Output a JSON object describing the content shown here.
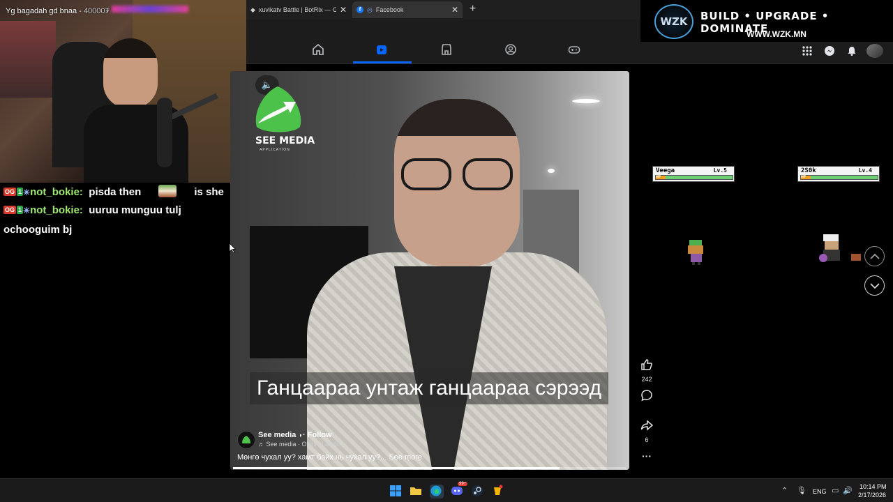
{
  "webcam_overlay": {
    "text": "Yg bagadah gd bnaa - ",
    "amount": "40000₮"
  },
  "chat": [
    {
      "badges": [
        "OG",
        "1"
      ],
      "user": "not_bokie:",
      "message": "pisda then",
      "emote": true,
      "after_emote": "is she"
    },
    {
      "badges": [
        "OG",
        "1"
      ],
      "user": "not_bokie:",
      "message": "uuruu munguu tulj"
    },
    {
      "continuation": "ochooguim bj"
    }
  ],
  "browser": {
    "tabs": [
      {
        "title": "xuvikatv Battle | BotRix — Cloud S",
        "active": false
      },
      {
        "title": "Facebook",
        "active": true
      }
    ],
    "nav": [
      "home-icon",
      "reels-icon",
      "marketplace-icon",
      "profile-icon",
      "gaming-icon"
    ],
    "active_nav": "reels-icon",
    "right_icons": [
      "menu-grid-icon",
      "messenger-icon",
      "notifications-icon",
      "account-avatar"
    ]
  },
  "banner": {
    "logo": "WZK",
    "tagline": "BUILD • UPGRADE • DOMINATE",
    "url": "WWW.WZK.MN"
  },
  "reel": {
    "watermark": "SEE MEDIA",
    "watermark_sub": "APPLICATION",
    "subtitle": "Ганцаараа унтаж ганцаараа сэрээд",
    "author": "See media",
    "follow": "· Follow",
    "audio": "♬ See media · Original audio",
    "caption": "Мөнгө чухал уу? хамт байх нь чухал уу?...",
    "see_more": "See more",
    "progress": 0.83,
    "likes": "242",
    "shares": "6"
  },
  "game": {
    "players": [
      {
        "name": "Veega",
        "level": "Lv.5",
        "hp": 1.0
      },
      {
        "name": "2S0k",
        "level": "Lv.4",
        "hp": 1.0
      }
    ],
    "hp_label": "HP"
  },
  "taskbar": {
    "lang": "ENG",
    "time": "10:14 PM",
    "date": "2/17/2026",
    "discord_badge": "99+"
  },
  "colors": {
    "facebook_blue": "#0866ff",
    "chat_username": "#9fe870",
    "hp_fill": "#6dcf73"
  }
}
